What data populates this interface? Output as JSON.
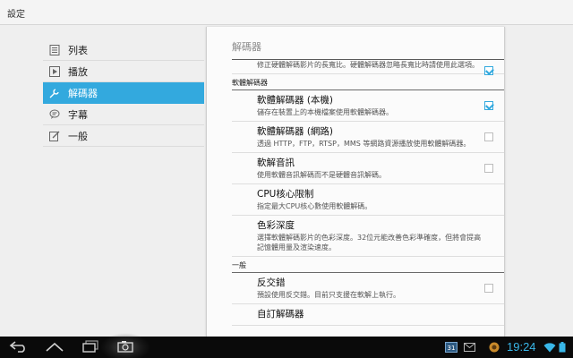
{
  "actionbar": {
    "title": "設定"
  },
  "sidebar": {
    "items": [
      {
        "label": "列表",
        "icon": "list-icon"
      },
      {
        "label": "播放",
        "icon": "play-icon"
      },
      {
        "label": "解碼器",
        "icon": "wrench-icon",
        "active": true
      },
      {
        "label": "字幕",
        "icon": "speech-bubble-icon"
      },
      {
        "label": "一般",
        "icon": "edit-icon"
      }
    ]
  },
  "panel": {
    "title": "解碼器",
    "top_item": {
      "summary": "修正硬體解碼影片的長寬比。硬體解碼器忽略長寬比時請使用此選項。",
      "checked": true
    },
    "category_software": "軟體解碼器",
    "prefs": [
      {
        "title": "軟體解碼器 (本機)",
        "summary": "儲存在裝置上的本機檔案使用軟體解碼器。",
        "checked": true
      },
      {
        "title": "軟體解碼器 (網路)",
        "summary": "透過 HTTP，FTP，RTSP，MMS 等網路資源播放使用軟體解碼器。",
        "checked": false
      },
      {
        "title": "軟解音訊",
        "summary": "使用軟體音訊解碼而不是硬體音訊解碼。",
        "checked": false
      },
      {
        "title": "CPU核心限制",
        "summary": "指定最大CPU核心數使用軟體解碼。"
      },
      {
        "title": "色彩深度",
        "summary": "選擇軟體解碼影片的色彩深度。32位元能改善色彩準確度，但將會提高記憶體用量及渲染速度。"
      }
    ],
    "category_general": "一般",
    "general_prefs": [
      {
        "title": "反交錯",
        "summary": "預設使用反交錯。目前只支援在軟解上執行。",
        "checked": false
      },
      {
        "title": "自訂解碼器",
        "summary": ""
      }
    ]
  },
  "navbar": {
    "time": "19:24",
    "calendar_day": "31",
    "accent": "#33a9de"
  }
}
